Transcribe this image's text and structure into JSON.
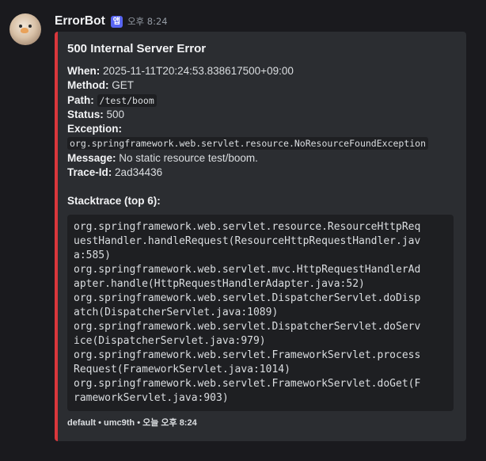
{
  "message": {
    "username": "ErrorBot",
    "badge": "앱",
    "timestamp": "오후 8:24"
  },
  "embed": {
    "accent_color": "#da373c",
    "title": "500 Internal Server Error",
    "fields": {
      "when_label": "When:",
      "when_value": "2025-11-11T20:24:53.838617500+09:00",
      "method_label": "Method:",
      "method_value": "GET",
      "path_label": "Path:",
      "path_value": "/test/boom",
      "status_label": "Status:",
      "status_value": "500",
      "exception_label": "Exception:",
      "exception_value": "org.springframework.web.servlet.resource.NoResourceFoundException",
      "message_label": "Message:",
      "message_value": "No static resource test/boom.",
      "trace_label": "Trace-Id:",
      "trace_value": "2ad34436"
    },
    "stacktrace_title": "Stacktrace (top 6):",
    "stacktrace_lines": [
      "org.springframework.web.servlet.resource.ResourceHttpReq",
      "uestHandler.handleRequest(ResourceHttpRequestHandler.jav",
      "a:585)",
      "org.springframework.web.servlet.mvc.HttpRequestHandlerAd",
      "apter.handle(HttpRequestHandlerAdapter.java:52)",
      "org.springframework.web.servlet.DispatcherServlet.doDisp",
      "atch(DispatcherServlet.java:1089)",
      "org.springframework.web.servlet.DispatcherServlet.doServ",
      "ice(DispatcherServlet.java:979)",
      "org.springframework.web.servlet.FrameworkServlet.process",
      "Request(FrameworkServlet.java:1014)",
      "org.springframework.web.servlet.FrameworkServlet.doGet(F",
      "rameworkServlet.java:903)"
    ],
    "footer": "default • umc9th • 오늘 오후 8:24"
  }
}
